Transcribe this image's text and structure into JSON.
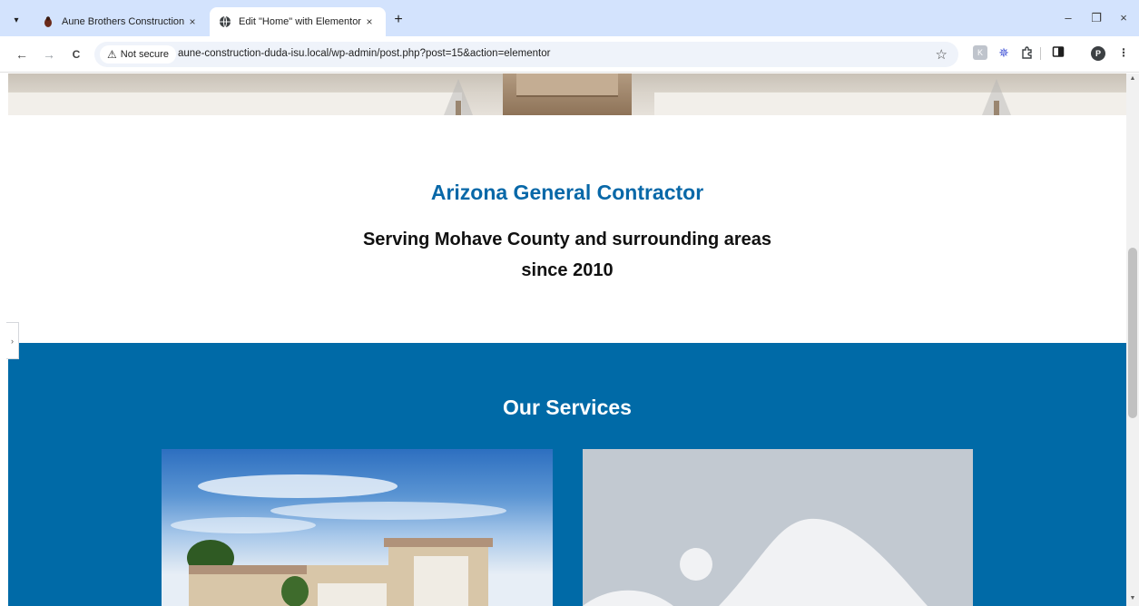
{
  "browser": {
    "tabs": [
      {
        "title": "Aune Brothers Construction",
        "favicon": "fire-ant-icon",
        "close": "×",
        "active": false
      },
      {
        "title": "Edit \"Home\" with Elementor",
        "favicon": "globe-icon",
        "close": "×",
        "active": true
      }
    ],
    "new_tab": "+",
    "window_controls": {
      "minimize": "–",
      "restore": "❐",
      "close": "×"
    },
    "nav": {
      "back": "←",
      "forward": "→",
      "reload": "C"
    },
    "security_chip": "Not secure",
    "security_icon": "⚠",
    "url": "aune-construction-duda-isu.local/wp-admin/post.php?post=15&action=elementor",
    "bookmark_star": "☆",
    "profile_initial": "P",
    "extensions": [
      "k-extension-icon",
      "sparkle-extension-icon",
      "puzzle-extensions-icon",
      "side-panel-icon"
    ],
    "menu": "⋮"
  },
  "page": {
    "intro": {
      "heading": "Arizona General Contractor",
      "sub_line1": "Serving Mohave County and surrounding areas",
      "sub_line2": "since 2010",
      "heading_color": "#0868a8"
    },
    "services": {
      "heading": "Our Services",
      "background_color": "#006aa7",
      "cards": [
        "house-photo",
        "image-placeholder"
      ]
    }
  },
  "editor": {
    "panel_toggle": "›"
  }
}
